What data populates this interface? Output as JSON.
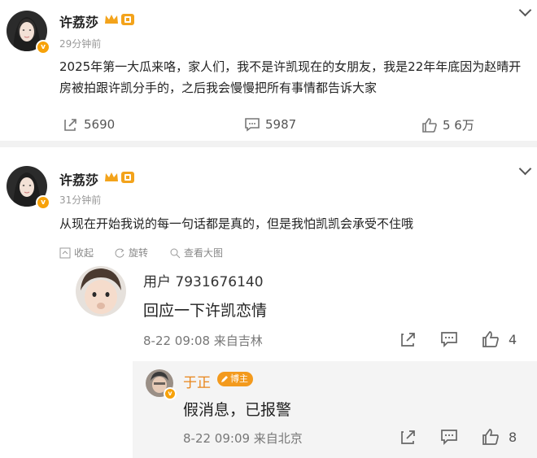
{
  "colors": {
    "badge": "#f7a20a",
    "crown": "#f3a31b",
    "pill": "#f39a1d",
    "background": "#f2f2f2"
  },
  "post1": {
    "author": "许荔莎",
    "time": "29分钟前",
    "text": "2025年第一大瓜来咯，家人们，我不是许凯现在的女朋友，我是22年年底因为赵晴开房被拍跟许凯分手的，之后我会慢慢把所有事情都告诉大家",
    "reposts": "5690",
    "comments": "5987",
    "likes": "5 6万",
    "icons": {
      "verified": "v-badge-icon",
      "crown": "crown-icon",
      "repost": "share-icon",
      "comment": "comment-icon",
      "like": "thumbs-up-icon",
      "menu": "chevron-down-icon"
    }
  },
  "post2": {
    "author": "许荔莎",
    "time": "31分钟前",
    "text": "从现在开始我说的每一句话都是真的，但是我怕凯凯会承受不住哦",
    "actions": {
      "collapse": "收起",
      "rotate": "旋转",
      "view_large": "查看大图"
    }
  },
  "reply1": {
    "user": "用户 7931676140",
    "text": "回应一下许凯恋情",
    "meta": "8-22 09:08 来自吉林",
    "likes": "4"
  },
  "reply2": {
    "user": "于正",
    "badge": "博主",
    "text": "假消息，已报警",
    "meta": "8-22 09:09 来自北京",
    "likes": "8"
  }
}
